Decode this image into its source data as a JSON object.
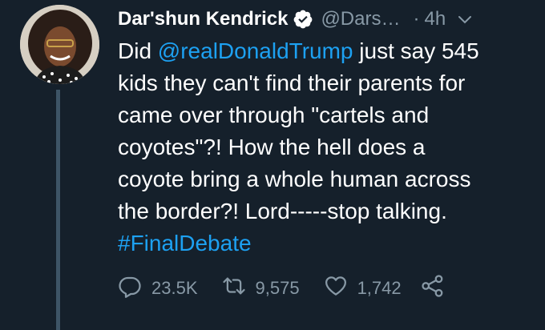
{
  "tweet": {
    "display_name": "Dar'shun Kendrick",
    "handle": "@Dars…",
    "separator": "·",
    "time": "4h",
    "text": {
      "line1_pre": "Did ",
      "mention": "@realDonaldTrump",
      "line1_post": " just say 545",
      "line2": "kids they can't find their parents for",
      "line3": "came over through \"cartels and",
      "line4": "coyotes\"?! How the hell does a",
      "line5": "coyote bring a whole human across",
      "line6": "the border?!  Lord-----stop talking.",
      "hashtag": "#FinalDebate"
    },
    "stats": {
      "replies": "23.5K",
      "retweets": "9,575",
      "likes": "1,742"
    }
  },
  "icons": {
    "verified": "verified-badge-icon",
    "menu": "chevron-down-icon",
    "reply": "reply-icon",
    "retweet": "retweet-icon",
    "like": "heart-icon",
    "share": "share-icon"
  },
  "colors": {
    "background": "#15202b",
    "text": "#ffffff",
    "secondary": "#8899a6",
    "link": "#1da1f2",
    "thread_line": "#3d5466"
  }
}
